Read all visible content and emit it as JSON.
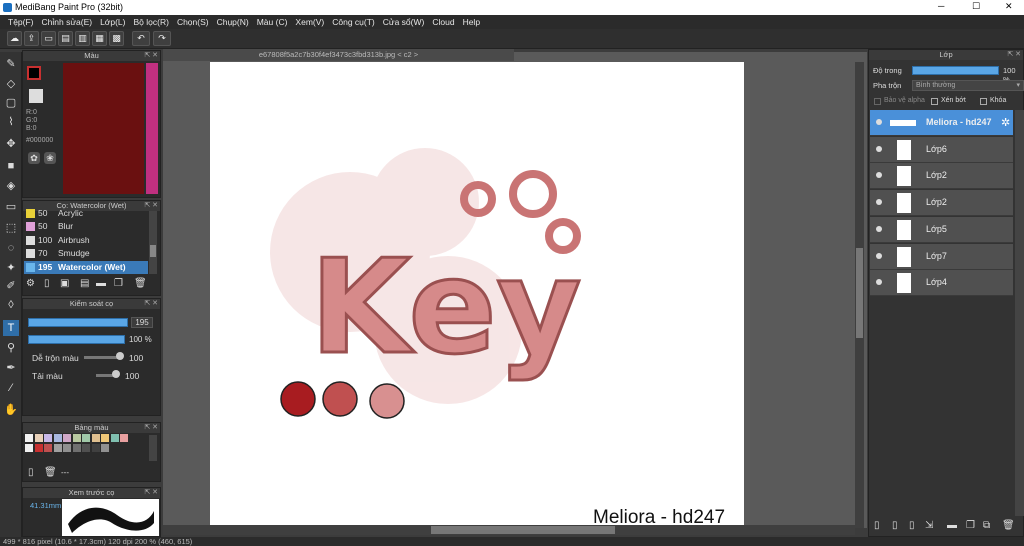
{
  "window": {
    "title": "MediBang Paint Pro (32bit)",
    "min": "─",
    "max": "☐",
    "close": "✕"
  },
  "menu": [
    "Tệp(F)",
    "Chỉnh sửa(E)",
    "Lớp(L)",
    "Bộ lọc(R)",
    "Chọn(S)",
    "Chụp(N)",
    "Màu (C)",
    "Xem(V)",
    "Công cụ(T)",
    "Cửa sổ(W)",
    "Cloud",
    "Help"
  ],
  "toolbar": {
    "undo_icon": "↶",
    "redo_icon": "↷"
  },
  "color_panel": {
    "title": "Màu",
    "r": "R:0",
    "g": "G:0",
    "b": "B:0",
    "hex": "#000000"
  },
  "brush_panel": {
    "title": "Cọ: Watercolor (Wet)",
    "items": [
      {
        "size": "50",
        "name": "Acrylic",
        "color": "#e8d038"
      },
      {
        "size": "50",
        "name": "Blur",
        "color": "#e0a0d8"
      },
      {
        "size": "100",
        "name": "Airbrush",
        "color": "#dddddd"
      },
      {
        "size": "70",
        "name": "Smudge",
        "color": "#dddddd"
      },
      {
        "size": "195",
        "name": "Watercolor (Wet)",
        "color": "#6ab6ec"
      }
    ]
  },
  "control_panel": {
    "title": "Kiểm soát cọ",
    "size_value": "195",
    "opacity_value": "100 %",
    "blend_label": "Dễ trộn màu",
    "blend_value": "100",
    "load_label": "Tải màu",
    "load_value": "100"
  },
  "palette_panel": {
    "title": "Bảng màu",
    "colors": [
      "#f2f2f2",
      "#e8d0b8",
      "#c8b8e8",
      "#a8b8e0",
      "#d0a8c8",
      "#b8c8a0",
      "#a0c8a8",
      "#e0c090",
      "#f0c878",
      "#80c0b0",
      "#e8a0a0",
      "#f0f0f0",
      "#c83030",
      "#c05050",
      "#a0a0a0",
      "#909090",
      "#707070",
      "#505050",
      "#404040",
      "#909090"
    ],
    "extra": "---"
  },
  "preview_panel": {
    "title": "Xem trước cọ",
    "size": "41.31mm"
  },
  "canvas": {
    "tab": "e67808f5a2c7b30f4ef3473c3fbd313b.jpg < c2 >",
    "signature": "Meliora - hd247",
    "art_text": "Key",
    "dots": [
      "#a81c20",
      "#c05050",
      "#d89090"
    ]
  },
  "status": "499 * 816 pixel   (10.6 * 17.3cm)   120 dpi   200 %   (460, 615)",
  "layers_panel": {
    "title": "Lớp",
    "opacity_label": "Độ trong",
    "opacity_value": "100 %",
    "blend_label": "Pha trộn",
    "blend_value": "Bình thường",
    "alpha_label": "Bảo vệ alpha",
    "clip_label": "Xén bớt",
    "lock_label": "Khóa",
    "layers": [
      {
        "name": "Meliora - hd247",
        "selected": true
      },
      {
        "name": "Lớp6"
      },
      {
        "name": "Lớp2"
      },
      {
        "name": "Lớp2"
      },
      {
        "name": "Lớp5"
      },
      {
        "name": "Lớp7"
      },
      {
        "name": "Lớp4"
      }
    ]
  }
}
